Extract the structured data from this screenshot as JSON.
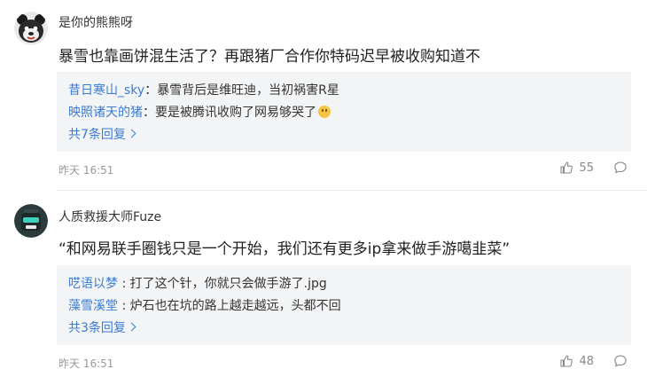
{
  "comments": [
    {
      "user": "是你的熊熊呀",
      "text": "暴雪也靠画饼混生活了？再跟猪厂合作你特码迟早被收购知道不",
      "replies": [
        {
          "user": "昔日寒山_sky",
          "sep": "：",
          "text": "暴雪背后是维旺迪，当初祸害R星"
        },
        {
          "user": "映照诸天的猪",
          "sep": "：",
          "text": "要是被腾讯收购了网易够哭了"
        }
      ],
      "more_label": "共7条回复",
      "time": "昨天 16:51",
      "likes": "55"
    },
    {
      "user": "人质救援大师Fuze",
      "text": "“和网易联手圈钱只是一个开始，我们还有更多ip拿来做手游噶韭菜”",
      "replies": [
        {
          "user": "呓语以梦",
          "sep": " : ",
          "text": "打了这个针，你就只会做手游了.jpg"
        },
        {
          "user": "藻雪溪堂",
          "sep": " : ",
          "text": "炉石也在坑的路上越走越远，头都不回"
        }
      ],
      "more_label": "共3条回复",
      "time": "昨天 16:51",
      "likes": "48"
    }
  ],
  "colors": {
    "link": "#3a7bd5",
    "reply_bg": "#f3f4f6",
    "meta": "#999999"
  },
  "icons": {
    "like": "thumbs-up-icon",
    "comment": "comment-bubble-icon",
    "more": "chevron-right-icon"
  }
}
